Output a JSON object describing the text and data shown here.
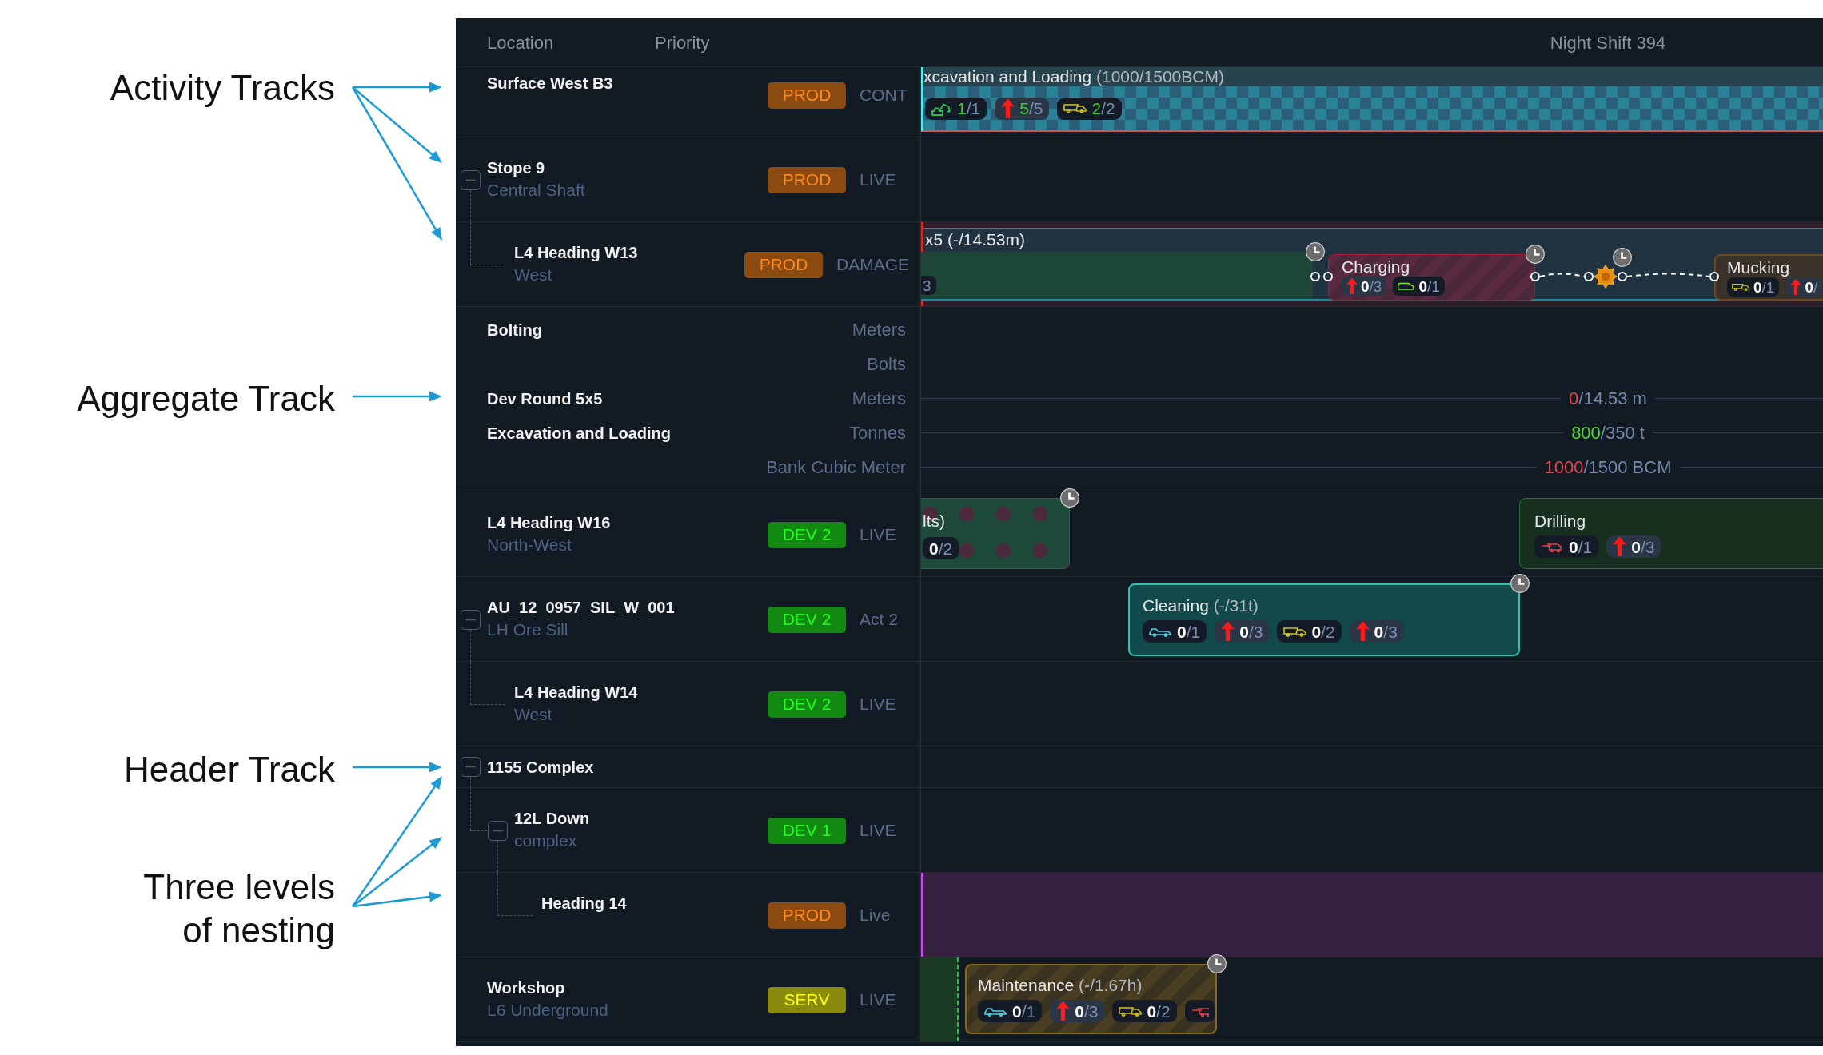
{
  "callouts": [
    {
      "label": "Activity Tracks"
    },
    {
      "label": "Aggregate Track"
    },
    {
      "label": "Header Track"
    },
    {
      "label": "Three levels of nesting"
    }
  ],
  "header": {
    "location": "Location",
    "priority": "Priority",
    "shift": "Night Shift 394"
  },
  "tracks": [
    {
      "kind": "activity",
      "name": "Surface West B3",
      "priority": {
        "label": "PROD",
        "color": "#8a4a10"
      },
      "status": "CONT",
      "activities": [
        {
          "kind": "summary",
          "title": "xcavation and Loading",
          "detail": "(1000/1500BCM)",
          "chips": [
            {
              "kind": "excavator",
              "done": "1",
              "total": "/1",
              "complete": true
            },
            {
              "kind": "arrow",
              "done": "5",
              "total": "/5",
              "complete": true
            },
            {
              "kind": "truck",
              "done": "2",
              "total": "/2",
              "complete": true
            }
          ]
        }
      ]
    },
    {
      "kind": "activity",
      "name": "Stope 9",
      "subtitle": "Central Shaft",
      "priority": {
        "label": "PROD",
        "color": "#8a4a10"
      },
      "status": "LIVE",
      "expanded": true,
      "children": [
        {
          "kind": "activity",
          "name": "L4 Heading W13",
          "subtitle": "West",
          "priority": {
            "label": "PROD",
            "color": "#8a4a10"
          },
          "status": "DAMAGE",
          "activities": [
            {
              "kind": "group",
              "title": "x5 (-/14.53m)"
            },
            {
              "kind": "task",
              "chips": [
                {
                  "total": "3"
                }
              ],
              "clock": true
            },
            {
              "kind": "task",
              "title": "Charging",
              "chips": [
                {
                  "kind": "arrow",
                  "done": "0",
                  "total": "/3",
                  "complete": false
                },
                {
                  "kind": "van",
                  "done": "0",
                  "total": "/1",
                  "complete": false
                }
              ],
              "clock": true
            },
            {
              "kind": "milestone",
              "clock": true
            },
            {
              "kind": "task",
              "title": "Mucking",
              "chips": [
                {
                  "kind": "truck",
                  "done": "0",
                  "total": "/1",
                  "complete": false
                },
                {
                  "kind": "arrow",
                  "done": "0",
                  "total": "/",
                  "complete": false
                }
              ]
            }
          ]
        }
      ]
    },
    {
      "kind": "aggregate",
      "groups": [
        {
          "name": "Bolting",
          "measures": [
            {
              "unit": "Meters"
            },
            {
              "unit": "Bolts"
            }
          ]
        },
        {
          "name": "Dev Round 5x5",
          "measures": [
            {
              "unit": "Meters",
              "actual": "0",
              "target": "/14.53 m",
              "color": "#e5484d"
            }
          ]
        },
        {
          "name": "Excavation and Loading",
          "measures": [
            {
              "unit": "Tonnes",
              "actual": "800",
              "target": "/350 t",
              "color": "#4ddb2a"
            },
            {
              "unit": "Bank Cubic Meter",
              "actual": "1000",
              "target": "/1500 BCM",
              "color": "#e5484d"
            }
          ]
        }
      ]
    },
    {
      "kind": "activity",
      "name": "L4 Heading W16",
      "subtitle": "North-West",
      "priority": {
        "label": "DEV 2",
        "color": "#128a12"
      },
      "status": "LIVE",
      "activities": [
        {
          "kind": "task",
          "title": "lts)",
          "chips": [
            {
              "done": "0",
              "total": "/2",
              "complete": false
            }
          ],
          "clock": true
        },
        {
          "kind": "task",
          "title": "Drilling",
          "chips": [
            {
              "kind": "machine",
              "done": "0",
              "total": "/1",
              "complete": false
            },
            {
              "kind": "arrow",
              "done": "0",
              "total": "/3",
              "complete": false
            }
          ]
        }
      ]
    },
    {
      "kind": "activity",
      "name": "AU_12_0957_SIL_W_001",
      "subtitle": "LH Ore Sill",
      "priority": {
        "label": "DEV 2",
        "color": "#128a12"
      },
      "status": "Act 2",
      "expanded": true,
      "activities": [
        {
          "kind": "task",
          "title": "Cleaning",
          "detail": "(-/31t)",
          "chips": [
            {
              "kind": "vehicle",
              "done": "0",
              "total": "/1",
              "complete": false
            },
            {
              "kind": "arrow",
              "done": "0",
              "total": "/3",
              "complete": false
            },
            {
              "kind": "truck",
              "done": "0",
              "total": "/2",
              "complete": false
            },
            {
              "kind": "arrow",
              "done": "0",
              "total": "/3",
              "complete": false
            }
          ],
          "clock": true
        }
      ],
      "children": [
        {
          "kind": "activity",
          "name": "L4 Heading W14",
          "subtitle": "West",
          "priority": {
            "label": "DEV 2",
            "color": "#128a12"
          },
          "status": "LIVE"
        }
      ]
    },
    {
      "kind": "header",
      "name": "1155 Complex",
      "expanded": true,
      "children": [
        {
          "kind": "activity",
          "name": "12L Down",
          "subtitle": "complex",
          "priority": {
            "label": "DEV 1",
            "color": "#128a12"
          },
          "status": "LIVE",
          "expanded": true,
          "children": [
            {
              "kind": "activity",
              "name": "Heading 14",
              "priority": {
                "label": "PROD",
                "color": "#8a4a10"
              },
              "status": "Live",
              "activities": [
                {
                  "kind": "span"
                }
              ]
            }
          ]
        }
      ]
    },
    {
      "kind": "activity",
      "name": "Workshop",
      "subtitle": "L6 Underground",
      "priority": {
        "label": "SERV",
        "color": "#8a8a0c"
      },
      "status": "LIVE",
      "activities": [
        {
          "kind": "lead"
        },
        {
          "kind": "task",
          "title": "Maintenance",
          "detail": "(-/1.67h)",
          "chips": [
            {
              "kind": "vehicle",
              "done": "0",
              "total": "/1",
              "complete": false
            },
            {
              "kind": "arrow",
              "done": "0",
              "total": "/3",
              "complete": false
            },
            {
              "kind": "truck",
              "done": "0",
              "total": "/2",
              "complete": false
            },
            {
              "kind": "machine"
            }
          ],
          "clock": true
        }
      ]
    }
  ]
}
